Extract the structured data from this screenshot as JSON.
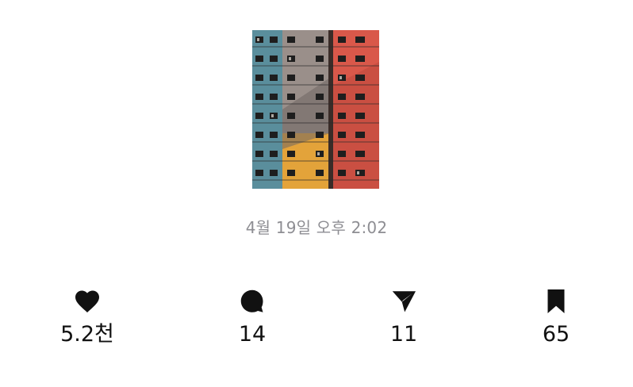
{
  "post": {
    "image_alt": "colorful apartment building facade",
    "timestamp": "4월 19일 오후 2:02"
  },
  "actions": [
    {
      "name": "like",
      "icon": "heart-icon",
      "count": "5.2천"
    },
    {
      "name": "comment",
      "icon": "comment-bubble-icon",
      "count": "14"
    },
    {
      "name": "share",
      "icon": "send-arrow-icon",
      "count": "11"
    },
    {
      "name": "save",
      "icon": "bookmark-icon",
      "count": "65"
    }
  ],
  "colors": {
    "icon": "#111111",
    "timestamp": "#8e8e93",
    "teal_wall": "#5a8e9c",
    "gray_wall": "#9a8f8a",
    "red_wall": "#d9584a",
    "yellow_wall": "#e3a33a"
  }
}
